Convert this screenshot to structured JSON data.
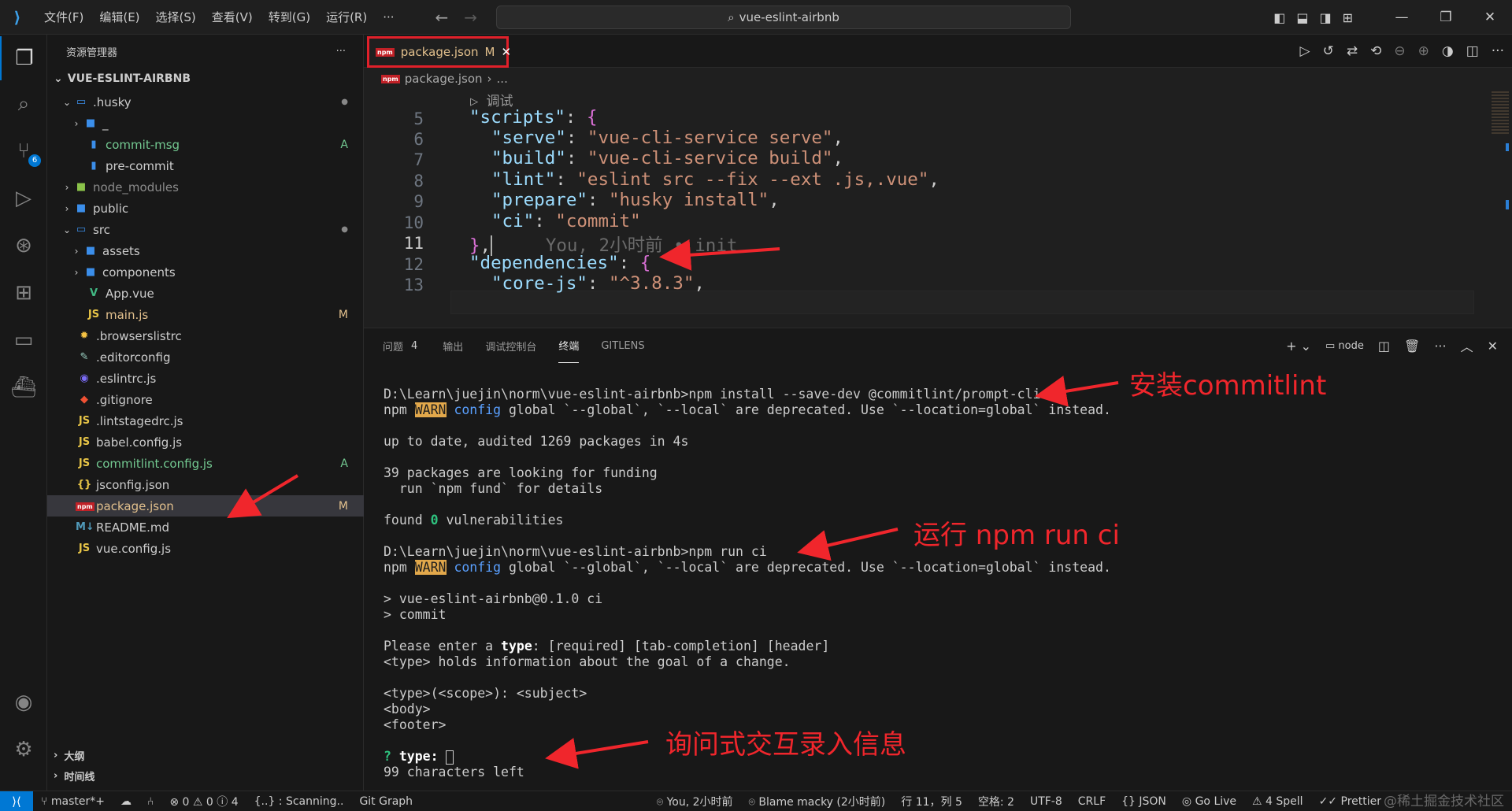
{
  "titlebar": {
    "menus": [
      "文件(F)",
      "编辑(E)",
      "选择(S)",
      "查看(V)",
      "转到(G)",
      "运行(R)",
      "···"
    ],
    "search": "vue-eslint-airbnb"
  },
  "activity": {
    "scm_badge": "6"
  },
  "sidebar": {
    "title": "资源管理器",
    "more": "···",
    "project": "VUE-ESLINT-AIRBNB",
    "items": [
      {
        "label": ".husky",
        "deco": "●"
      },
      {
        "label": "_",
        "deco": ""
      },
      {
        "label": "commit-msg",
        "deco": "A"
      },
      {
        "label": "pre-commit",
        "deco": ""
      },
      {
        "label": "node_modules",
        "deco": ""
      },
      {
        "label": "public",
        "deco": ""
      },
      {
        "label": "src",
        "deco": "●"
      },
      {
        "label": "assets",
        "deco": ""
      },
      {
        "label": "components",
        "deco": ""
      },
      {
        "label": "App.vue",
        "deco": ""
      },
      {
        "label": "main.js",
        "deco": "M"
      },
      {
        "label": ".browserslistrc",
        "deco": ""
      },
      {
        "label": ".editorconfig",
        "deco": ""
      },
      {
        "label": ".eslintrc.js",
        "deco": ""
      },
      {
        "label": ".gitignore",
        "deco": ""
      },
      {
        "label": ".lintstagedrc.js",
        "deco": ""
      },
      {
        "label": "babel.config.js",
        "deco": ""
      },
      {
        "label": "commitlint.config.js",
        "deco": "A"
      },
      {
        "label": "jsconfig.json",
        "deco": ""
      },
      {
        "label": "package.json",
        "deco": "M"
      },
      {
        "label": "README.md",
        "deco": ""
      },
      {
        "label": "vue.config.js",
        "deco": ""
      }
    ],
    "outline": "大纲",
    "timeline": "时间线"
  },
  "editor": {
    "tab_label": "package.json",
    "tab_status": "M",
    "breadcrumb": [
      "package.json",
      "..."
    ],
    "codelens": "▷ 调试",
    "line_numbers": [
      "5",
      "6",
      "7",
      "8",
      "9",
      "10",
      "11",
      "12",
      "13"
    ],
    "lines": {
      "l5_key": "\"scripts\"",
      "l6_key": "\"serve\"",
      "l6_val": "\"vue-cli-service serve\"",
      "l7_key": "\"build\"",
      "l7_val": "\"vue-cli-service build\"",
      "l8_key": "\"lint\"",
      "l8_val": "\"eslint src --fix --ext .js,.vue\"",
      "l9_key": "\"prepare\"",
      "l9_val": "\"husky install\"",
      "l10_key": "\"ci\"",
      "l10_val": "\"commit\"",
      "l11_blame": "You, 2小时前 • init",
      "l12_key": "\"dependencies\"",
      "l13_key": "\"core-js\"",
      "l13_val": "\"^3.8.3\""
    }
  },
  "panel": {
    "tabs": [
      "问题",
      "输出",
      "调试控制台",
      "终端",
      "GITLENS"
    ],
    "problems_count": "4",
    "shell": "node",
    "terminal": {
      "cmd1": "D:\\Learn\\juejin\\norm\\vue-eslint-airbnb>npm install --save-dev @commitlint/prompt-cli",
      "npm": "npm",
      "warn": "WARN",
      "config": "config",
      "warn_rest": " global `--global`, `--local` are deprecated. Use `--location=global` instead.",
      "uptodate": "up to date, audited 1269 packages in 4s",
      "funding1": "39 packages are looking for funding",
      "funding2": "  run `npm fund` for details",
      "found_a": "found ",
      "found_zero": "0",
      "found_b": " vulnerabilities",
      "cmd2": "D:\\Learn\\juejin\\norm\\vue-eslint-airbnb>npm run ci",
      "run1": "> vue-eslint-airbnb@0.1.0 ci",
      "run2": "> commit",
      "enter_a": "Please enter a ",
      "enter_type": "type",
      "enter_b": ": [required] [tab-completion] [header]",
      "holds": "<type> holds information about the goal of a change.",
      "fmt1": "<type>(<scope>): <subject>",
      "fmt2": "<body>",
      "fmt3": "<footer>",
      "prompt_q": "?",
      "prompt_type": "type:",
      "left": "99 characters left"
    }
  },
  "annotations": {
    "install": "安装commitlint",
    "run": "运行 npm run ci",
    "ask": "询问式交互录入信息"
  },
  "statusbar": {
    "branch": "master*+",
    "errors": "⊗ 0 ⚠ 0 ⓘ 4",
    "scanning": "{..} : Scanning..",
    "gitgraph": "Git Graph",
    "blame_you": "You, 2小时前",
    "blame": "Blame macky (2小时前)",
    "position": "行 11，列 5",
    "spaces": "空格: 2",
    "encoding": "UTF-8",
    "eol": "CRLF",
    "lang": "{} JSON",
    "golive": "Go Live",
    "spell": "4 Spell",
    "prettier": "Prettier"
  },
  "watermark": "@稀土掘金技术社区"
}
